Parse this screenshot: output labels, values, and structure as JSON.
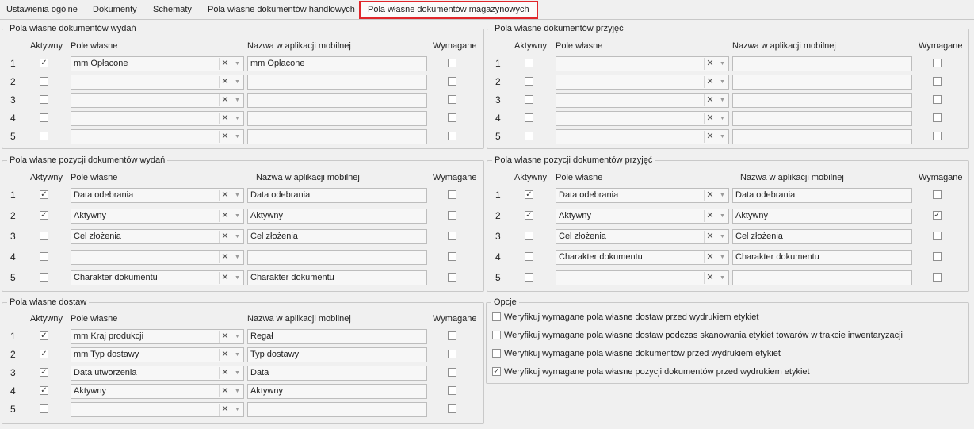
{
  "tabs": [
    {
      "label": "Ustawienia ogólne",
      "active": false
    },
    {
      "label": "Dokumenty",
      "active": false
    },
    {
      "label": "Schematy",
      "active": false
    },
    {
      "label": "Pola własne dokumentów handlowych",
      "active": false
    },
    {
      "label": "Pola własne dokumentów magazynowych",
      "active": true
    }
  ],
  "headers": {
    "active": "Aktywny",
    "field": "Pole własne",
    "mobile_name": "Nazwa w aplikacji mobilnej",
    "required": "Wymagane"
  },
  "clear_icon": "x-icon",
  "dropdown_icon": "chevron-down-icon",
  "groups": [
    {
      "title": "Pola własne dokumentów wydań",
      "rows": [
        {
          "num": "1",
          "active": true,
          "field": "mm Opłacone",
          "mobile": "mm Opłacone",
          "required": false
        },
        {
          "num": "2",
          "active": false,
          "field": "",
          "mobile": "",
          "required": false
        },
        {
          "num": "3",
          "active": false,
          "field": "",
          "mobile": "",
          "required": false
        },
        {
          "num": "4",
          "active": false,
          "field": "",
          "mobile": "",
          "required": false
        },
        {
          "num": "5",
          "active": false,
          "field": "",
          "mobile": "",
          "required": false
        }
      ]
    },
    {
      "title": "Pola własne dokumentów przyjęć",
      "rows": [
        {
          "num": "1",
          "active": false,
          "field": "",
          "mobile": "",
          "required": false
        },
        {
          "num": "2",
          "active": false,
          "field": "",
          "mobile": "",
          "required": false
        },
        {
          "num": "3",
          "active": false,
          "field": "",
          "mobile": "",
          "required": false
        },
        {
          "num": "4",
          "active": false,
          "field": "",
          "mobile": "",
          "required": false
        },
        {
          "num": "5",
          "active": false,
          "field": "",
          "mobile": "",
          "required": false
        }
      ]
    },
    {
      "title": "Pola własne pozycji dokumentów wydań",
      "rows": [
        {
          "num": "1",
          "active": true,
          "field": "Data odebrania",
          "mobile": "Data odebrania",
          "required": false
        },
        {
          "num": "2",
          "active": true,
          "field": "Aktywny",
          "mobile": "Aktywny",
          "required": false
        },
        {
          "num": "3",
          "active": false,
          "field": "Cel złożenia",
          "mobile": "Cel złożenia",
          "required": false
        },
        {
          "num": "4",
          "active": false,
          "field": "",
          "mobile": "",
          "required": false
        },
        {
          "num": "5",
          "active": false,
          "field": "Charakter dokumentu",
          "mobile": "Charakter dokumentu",
          "required": false
        }
      ]
    },
    {
      "title": "Pola własne pozycji dokumentów przyjęć",
      "rows": [
        {
          "num": "1",
          "active": true,
          "field": "Data odebrania",
          "mobile": "Data odebrania",
          "required": false
        },
        {
          "num": "2",
          "active": true,
          "field": "Aktywny",
          "mobile": "Aktywny",
          "required": true
        },
        {
          "num": "3",
          "active": false,
          "field": "Cel złożenia",
          "mobile": "Cel złożenia",
          "required": false
        },
        {
          "num": "4",
          "active": false,
          "field": "Charakter dokumentu",
          "mobile": "Charakter dokumentu",
          "required": false
        },
        {
          "num": "5",
          "active": false,
          "field": "",
          "mobile": "",
          "required": false
        }
      ]
    },
    {
      "title": "Pola własne dostaw",
      "rows": [
        {
          "num": "1",
          "active": true,
          "field": "mm Kraj produkcji",
          "mobile": "Regał",
          "required": false
        },
        {
          "num": "2",
          "active": true,
          "field": "mm Typ dostawy",
          "mobile": "Typ dostawy",
          "required": false
        },
        {
          "num": "3",
          "active": true,
          "field": "Data utworzenia",
          "mobile": "Data",
          "required": false
        },
        {
          "num": "4",
          "active": true,
          "field": "Aktywny",
          "mobile": "Aktywny",
          "required": false
        },
        {
          "num": "5",
          "active": false,
          "field": "",
          "mobile": "",
          "required": false
        }
      ]
    }
  ],
  "options": {
    "title": "Opcje",
    "items": [
      {
        "label": "Weryfikuj wymagane pola własne dostaw przed wydrukiem etykiet",
        "checked": false
      },
      {
        "label": "Weryfikuj wymagane pola własne dostaw podczas skanowania etykiet towarów w trakcie inwentaryzacji",
        "checked": false
      },
      {
        "label": "Weryfikuj wymagane pola własne dokumentów przed wydrukiem etykiet",
        "checked": false
      },
      {
        "label": "Weryfikuj wymagane pola własne pozycji dokumentów przed wydrukiem etykiet",
        "checked": true
      }
    ]
  }
}
